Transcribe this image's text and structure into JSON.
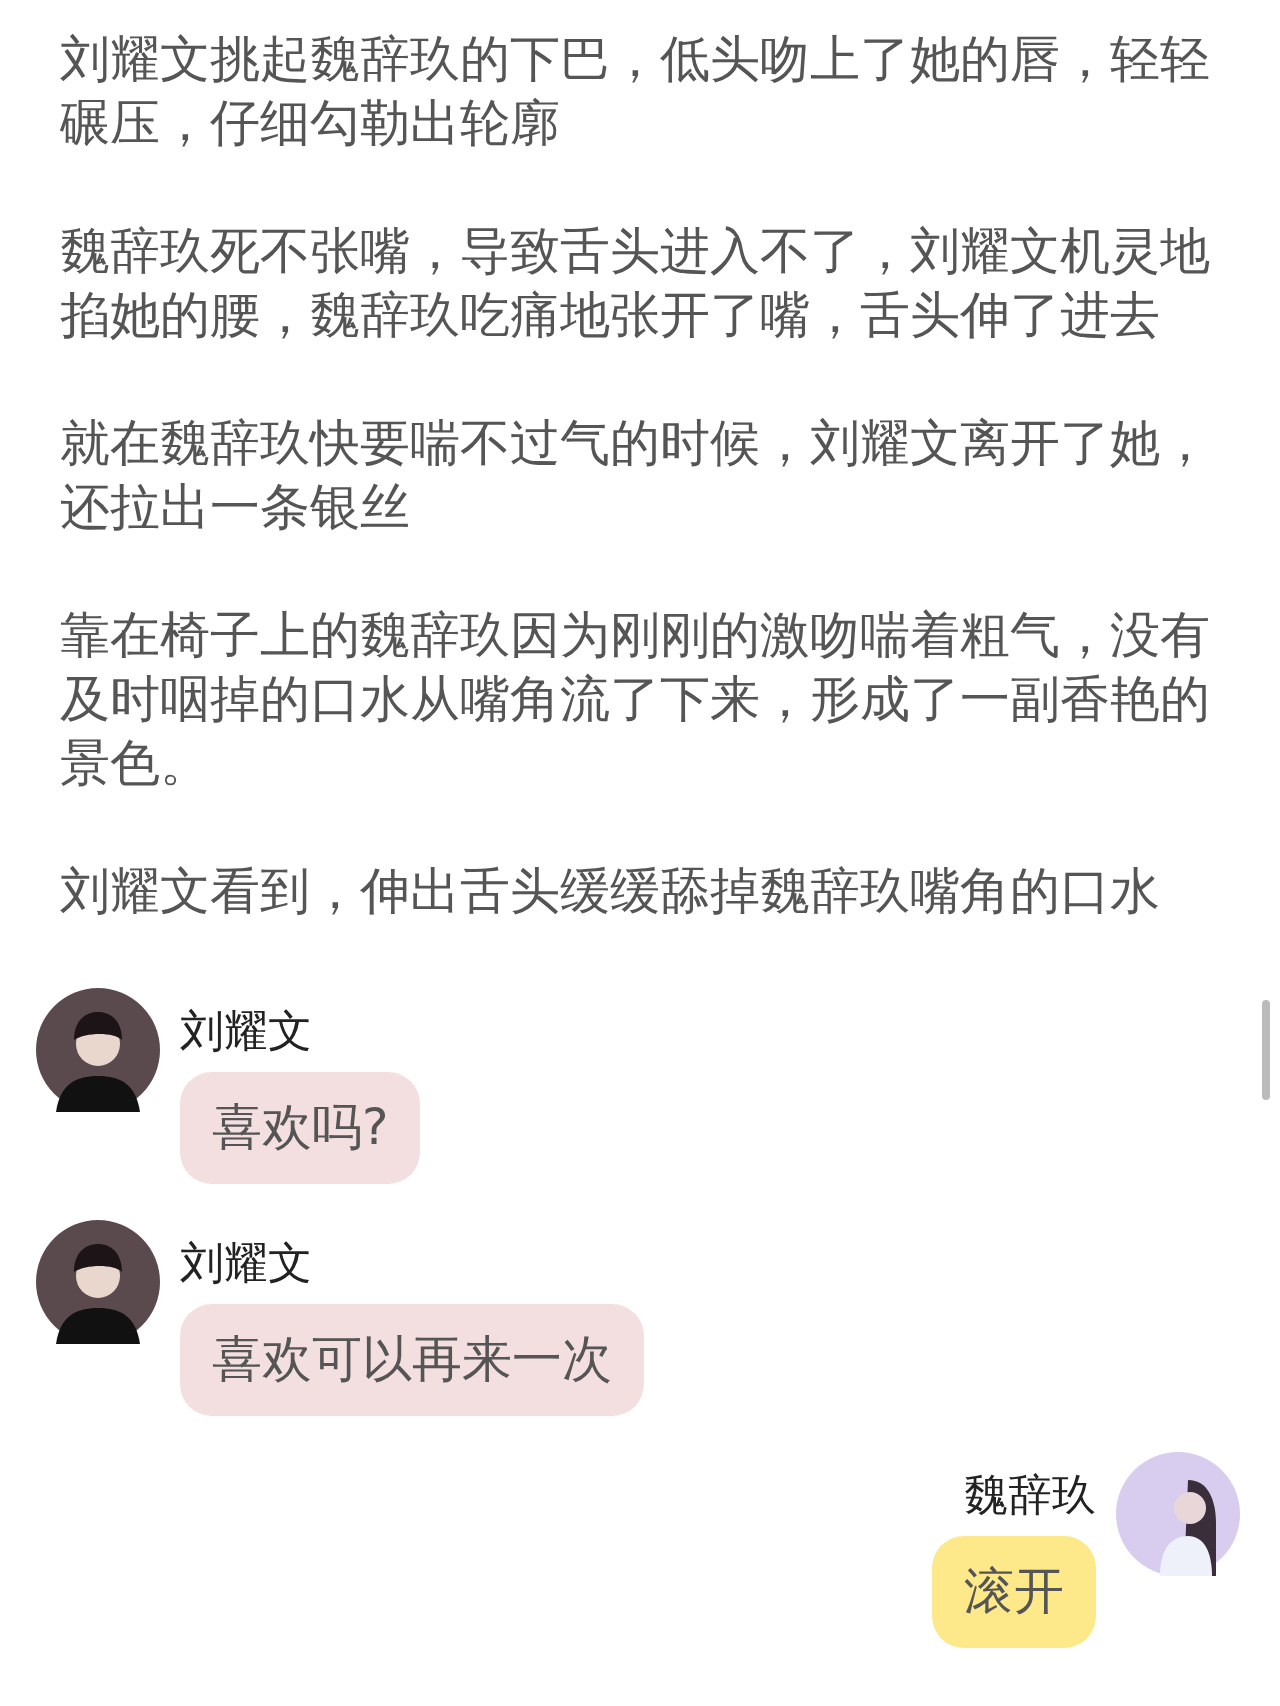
{
  "paragraphs": [
    "刘耀文挑起魏辞玖的下巴，低头吻上了她的唇，轻轻碾压，仔细勾勒出轮廓",
    "魏辞玖死不张嘴，导致舌头进入不了，刘耀文机灵地掐她的腰，魏辞玖吃痛地张开了嘴，舌头伸了进去",
    "就在魏辞玖快要喘不过气的时候，刘耀文离开了她，还拉出一条银丝",
    "靠在椅子上的魏辞玖因为刚刚的激吻喘着粗气，没有及时咽掉的口水从嘴角流了下来，形成了一副香艳的景色。",
    "刘耀文看到，伸出舌头缓缓舔掉魏辞玖嘴角的口水"
  ],
  "messages": [
    {
      "kind": "received",
      "name": "刘耀文",
      "text": "喜欢吗?"
    },
    {
      "kind": "received",
      "name": "刘耀文",
      "text": "喜欢可以再来一次"
    },
    {
      "kind": "sent",
      "name": "魏辞玖",
      "text": "滚开"
    }
  ]
}
